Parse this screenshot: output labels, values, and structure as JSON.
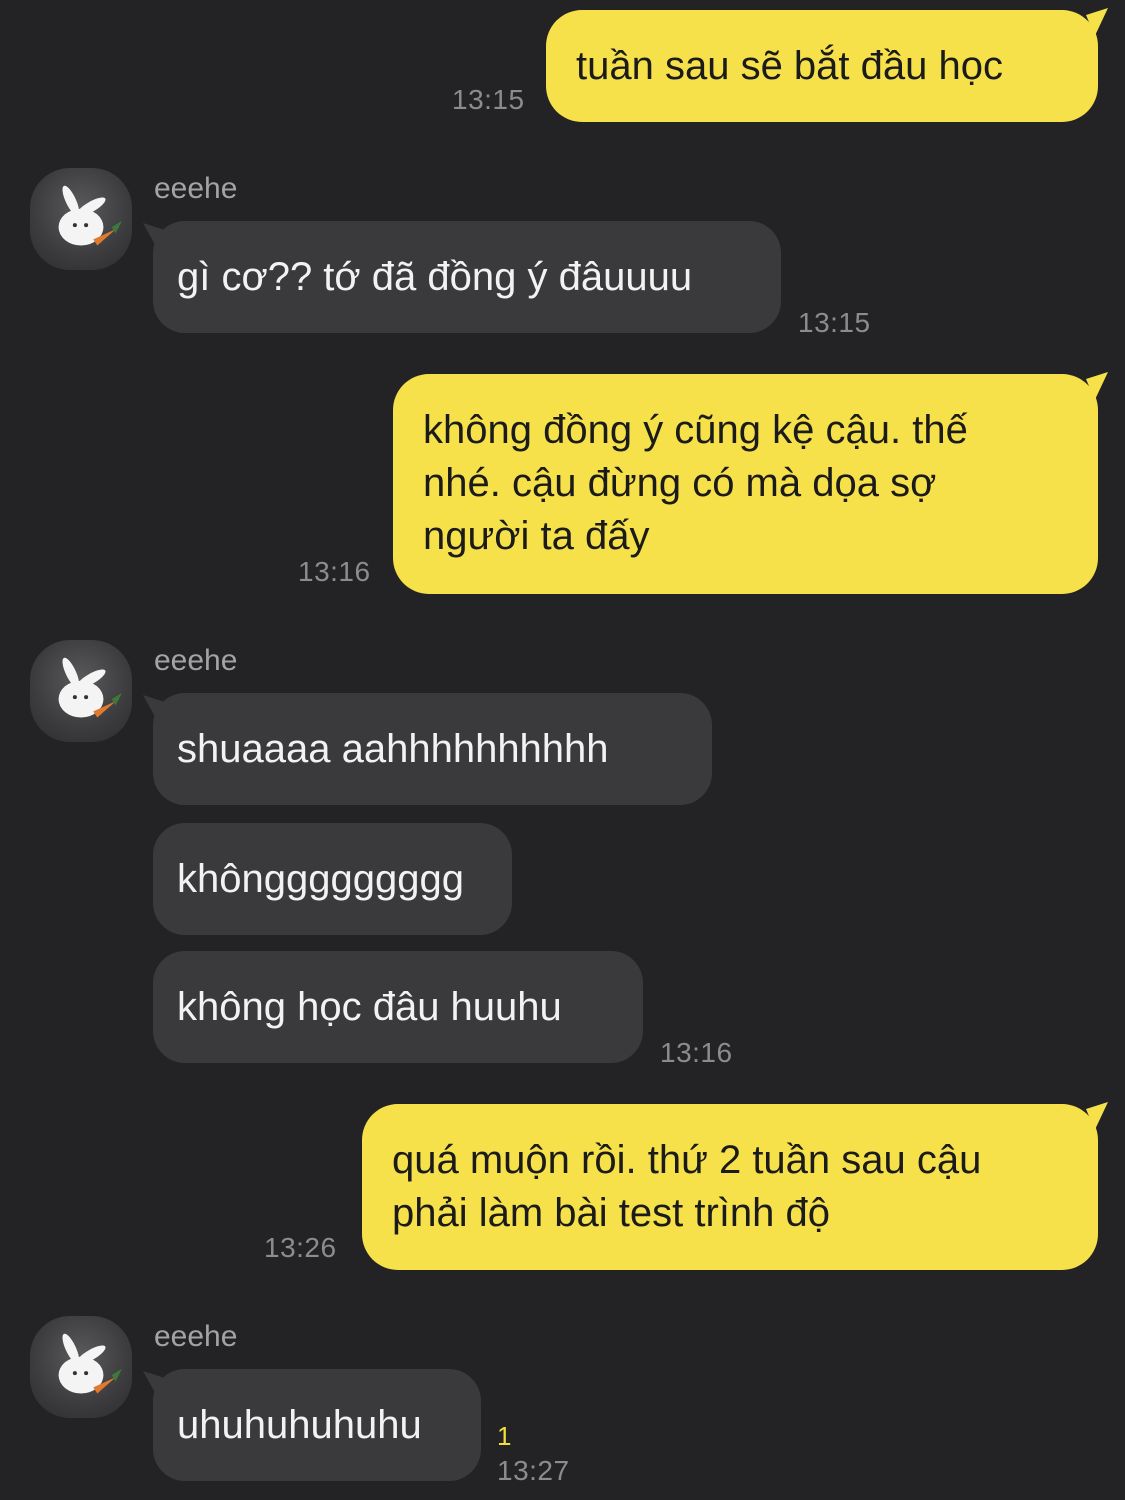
{
  "conversation": {
    "messages": [
      {
        "from": "me",
        "text": "tuần sau sẽ bắt đầu học",
        "time": "13:15"
      },
      {
        "from": "eeehe",
        "sender_name": "eeehe",
        "text": "gì cơ?? tớ đã đồng ý đâuuuu",
        "time": "13:15"
      },
      {
        "from": "me",
        "lines": [
          "không đồng ý cũng kệ cậu. thế",
          "nhé. cậu đừng có mà dọa sợ",
          "người ta đấy"
        ],
        "time": "13:16"
      },
      {
        "from": "eeehe",
        "sender_name": "eeehe",
        "texts": [
          "shuaaaa aahhhhhhhhhh",
          "khônggggggggg",
          "không học đâu huuhu"
        ],
        "time": "13:16"
      },
      {
        "from": "me",
        "lines": [
          "quá muộn rồi. thứ 2 tuần sau cậu",
          "phải làm bài test trình độ"
        ],
        "time": "13:26"
      },
      {
        "from": "eeehe",
        "sender_name": "eeehe",
        "text": "uhuhuhuhuhu",
        "time": "13:27",
        "unread_count": "1"
      }
    ]
  },
  "colors": {
    "background": "#232325",
    "my_bubble": "#f7e14a",
    "their_bubble": "#3a3a3c",
    "unread": "#f2dd3a"
  },
  "icons": {
    "avatar": "white-rabbit-with-carrot-avatar"
  }
}
